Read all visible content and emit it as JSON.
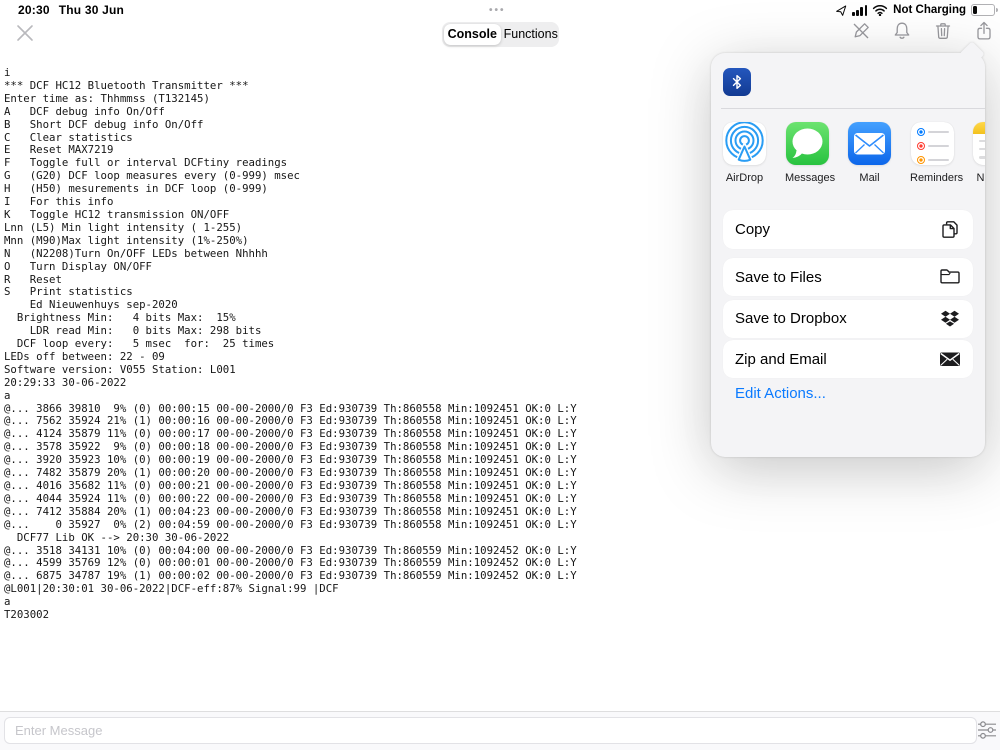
{
  "status_bar": {
    "time": "20:30",
    "date": "Thu 30 Jun",
    "center_indicator": "•••",
    "battery_label": "Not Charging"
  },
  "toolbar": {
    "tabs": [
      {
        "label": "Console",
        "selected": true
      },
      {
        "label": "Functions",
        "selected": false
      }
    ]
  },
  "console": {
    "lines": [
      "i",
      "*** DCF HC12 Bluetooth Transmitter ***",
      "Enter time as: Thhmmss (T132145)",
      "A   DCF debug info On/Off",
      "B   Short DCF debug info On/Off",
      "C   Clear statistics",
      "E   Reset MAX7219",
      "F   Toggle full or interval DCFtiny readings",
      "G   (G20) DCF loop measures every (0-999) msec",
      "H   (H50) mesurements in DCF loop (0-999)",
      "I   For this info",
      "K   Toggle HC12 transmission ON/OFF",
      "Lnn (L5) Min light intensity ( 1-255)",
      "Mnn (M90)Max light intensity (1%-250%)",
      "N   (N2208)Turn On/OFF LEDs between Nhhhh",
      "O   Turn Display ON/OFF",
      "R   Reset",
      "S   Print statistics",
      "    Ed Nieuwenhuys sep-2020",
      "  Brightness Min:   4 bits Max:  15%",
      "    LDR read Min:   0 bits Max: 298 bits",
      "  DCF loop every:   5 msec  for:  25 times",
      "LEDs off between: 22 - 09",
      "Software version: V055 Station: L001",
      "20:29:33 30-06-2022",
      "a",
      "@... 3866 39810  9% (0) 00:00:15 00-00-2000/0 F3 Ed:930739 Th:860558 Min:1092451 OK:0 L:Y",
      "@... 7562 35924 21% (1) 00:00:16 00-00-2000/0 F3 Ed:930739 Th:860558 Min:1092451 OK:0 L:Y",
      "@... 4124 35879 11% (0) 00:00:17 00-00-2000/0 F3 Ed:930739 Th:860558 Min:1092451 OK:0 L:Y",
      "@... 3578 35922  9% (0) 00:00:18 00-00-2000/0 F3 Ed:930739 Th:860558 Min:1092451 OK:0 L:Y",
      "@... 3920 35923 10% (0) 00:00:19 00-00-2000/0 F3 Ed:930739 Th:860558 Min:1092451 OK:0 L:Y",
      "@... 7482 35879 20% (1) 00:00:20 00-00-2000/0 F3 Ed:930739 Th:860558 Min:1092451 OK:0 L:Y",
      "@... 4016 35682 11% (0) 00:00:21 00-00-2000/0 F3 Ed:930739 Th:860558 Min:1092451 OK:0 L:Y",
      "@... 4044 35924 11% (0) 00:00:22 00-00-2000/0 F3 Ed:930739 Th:860558 Min:1092451 OK:0 L:Y",
      "@... 7412 35884 20% (1) 00:04:23 00-00-2000/0 F3 Ed:930739 Th:860558 Min:1092451 OK:0 L:Y",
      "@...    0 35927  0% (2) 00:04:59 00-00-2000/0 F3 Ed:930739 Th:860558 Min:1092451 OK:0 L:Y",
      "  DCF77 Lib OK --> 20:30 30-06-2022",
      "@... 3518 34131 10% (0) 00:04:00 00-00-2000/0 F3 Ed:930739 Th:860559 Min:1092452 OK:0 L:Y",
      "@... 4599 35769 12% (0) 00:00:01 00-00-2000/0 F3 Ed:930739 Th:860559 Min:1092452 OK:0 L:Y",
      "@... 6875 34787 19% (1) 00:00:02 00-00-2000/0 F3 Ed:930739 Th:860559 Min:1092452 OK:0 L:Y",
      "@L001|20:30:01 30-06-2022|DCF-eff:87% Signal:99 |DCF",
      "a",
      "T203002"
    ]
  },
  "share_sheet": {
    "source_icon": "bluetooth",
    "apps": [
      {
        "label": "AirDrop"
      },
      {
        "label": "Messages"
      },
      {
        "label": "Mail"
      },
      {
        "label": "Reminders"
      },
      {
        "label": "N"
      }
    ],
    "actions": [
      {
        "label": "Copy",
        "icon": "copy-icon"
      },
      {
        "label": "Save to Files",
        "icon": "folder-icon"
      },
      {
        "label": "Save to Dropbox",
        "icon": "dropbox-icon"
      },
      {
        "label": "Zip and Email",
        "icon": "envelope-filled-icon"
      }
    ],
    "edit_actions_label": "Edit Actions..."
  },
  "message_bar": {
    "placeholder": "Enter Message"
  },
  "colors": {
    "accent_blue": "#0a7aff",
    "bluetooth_blue": "#1a47a5",
    "messages_green": "#45d354",
    "mail_blue": "#2d8cfd",
    "airdrop_blue": "#2a9df4",
    "reminders_bullets": [
      "#007aff",
      "#ff3b30",
      "#ff9500"
    ],
    "notes_yellow": "#ffd84a"
  }
}
